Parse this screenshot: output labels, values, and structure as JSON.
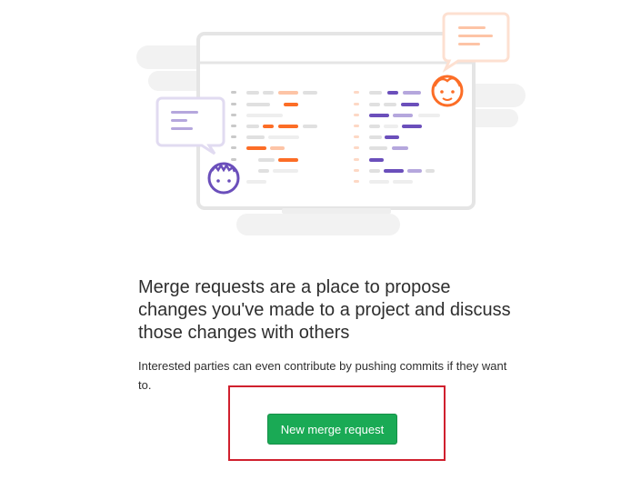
{
  "empty_state": {
    "title": "Merge requests are a place to propose changes you've made to a project and discuss those changes with others",
    "description": "Interested parties can even contribute by pushing commits if they want to.",
    "button_label": "New merge request"
  },
  "colors": {
    "primary_button": "#1aaa55",
    "highlight_border": "#d0202e",
    "accent_orange": "#fc6d26",
    "accent_purple": "#6b4fbb"
  }
}
